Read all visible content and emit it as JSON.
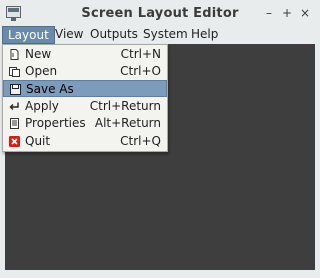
{
  "window": {
    "title": "Screen Layout Editor",
    "controls": {
      "minimize": "–",
      "maximize": "+",
      "close": "×"
    }
  },
  "menubar": {
    "items": [
      {
        "label": "Layout"
      },
      {
        "label": "View"
      },
      {
        "label": "Outputs"
      },
      {
        "label": "System"
      },
      {
        "label": "Help"
      }
    ]
  },
  "layout_menu": {
    "items": [
      {
        "label": "New",
        "shortcut": "Ctrl+N",
        "icon": "new-document-icon"
      },
      {
        "label": "Open",
        "shortcut": "Ctrl+O",
        "icon": "open-icon"
      },
      {
        "label": "Save As",
        "shortcut": "",
        "icon": "save-icon"
      },
      {
        "label": "Apply",
        "shortcut": "Ctrl+Return",
        "icon": "apply-icon"
      },
      {
        "label": "Properties",
        "shortcut": "Alt+Return",
        "icon": "properties-icon"
      },
      {
        "label": "Quit",
        "shortcut": "Ctrl+Q",
        "icon": "quit-icon"
      }
    ]
  },
  "colors": {
    "highlight": "#7d9bba",
    "menu_active": "#698ba9",
    "canvas": "#3e3e3e"
  }
}
